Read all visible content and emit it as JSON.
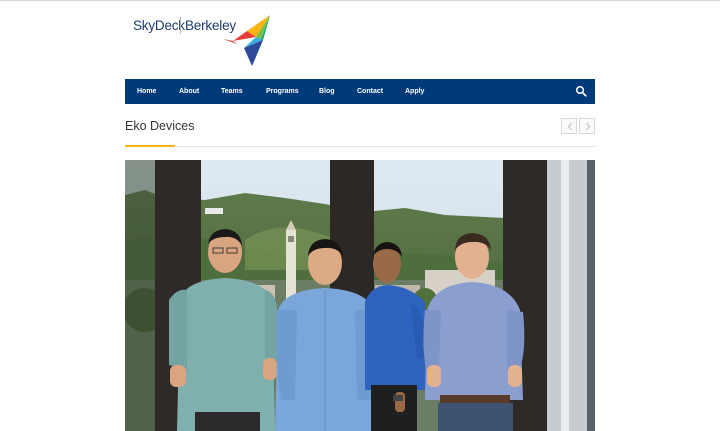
{
  "logo": {
    "brand": "SkyDeck",
    "affiliate": "Berkeley",
    "mark_icon": "paper-plane-icon",
    "mark_colors": [
      "#e83e3a",
      "#fdb515",
      "#3ab0dc",
      "#7ac043",
      "#2f4a9b",
      "#00a99d"
    ]
  },
  "nav": {
    "items": [
      "Home",
      "About",
      "Teams",
      "Programs",
      "Blog",
      "Contact",
      "Apply"
    ],
    "search_icon": "search-icon",
    "background": "#003a79"
  },
  "page": {
    "title": "Eko Devices",
    "accent_color": "#fdb515",
    "prev_icon": "chevron-left-icon",
    "next_icon": "chevron-right-icon"
  },
  "photo": {
    "subject": "team-photo"
  }
}
